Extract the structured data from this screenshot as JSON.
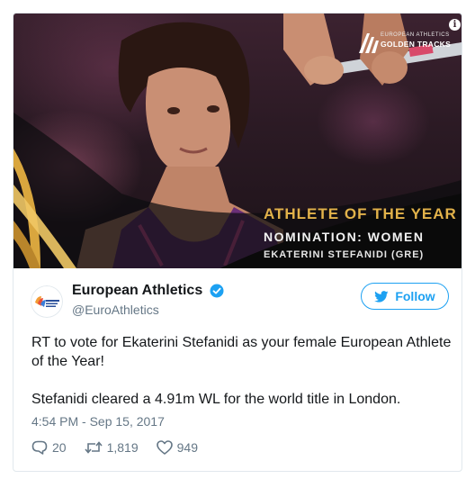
{
  "media": {
    "headline": "ATHLETE OF THE YEAR",
    "nomination": "NOMINATION: WOMEN",
    "athlete": "EKATERINI STEFANIDI (GRE)",
    "brand_top": "EUROPEAN ATHLETICS",
    "brand_main": "GOLDEN TRACKS",
    "info_glyph": "i"
  },
  "author": {
    "name": "European Athletics",
    "handle": "@EuroAthletics",
    "verified": true,
    "avatar_icon": "european-athletics-logo"
  },
  "follow": {
    "label": "Follow",
    "icon": "twitter-bird-icon"
  },
  "tweet": {
    "paragraphs": [
      "RT to vote for Ekaterini Stefanidi as your female European Athlete of the Year!",
      "Stefanidi cleared a 4.91m WL for the world title in London."
    ],
    "timestamp": "4:54 PM - Sep 15, 2017"
  },
  "actions": {
    "replies": "20",
    "retweets": "1,819",
    "likes": "949"
  },
  "colors": {
    "accent": "#1da1f2",
    "gold": "#e2b24a",
    "secondary_text": "#657786",
    "border": "#e1e8ed"
  }
}
